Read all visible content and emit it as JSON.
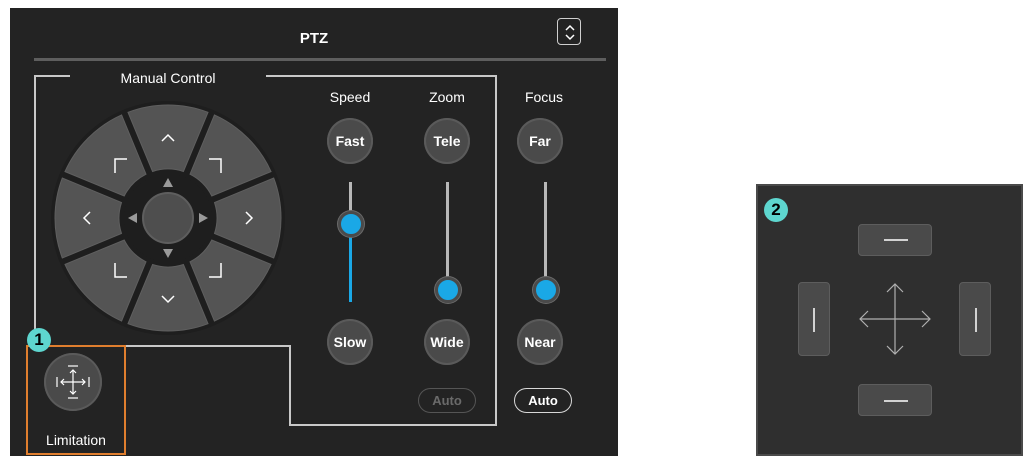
{
  "ptz": {
    "title": "PTZ",
    "collapse_icon": "chevron-up-down-icon"
  },
  "manual_control": {
    "label": "Manual Control",
    "dpad_icons": [
      "arrow-up-icon",
      "arrow-down-icon",
      "arrow-left-icon",
      "arrow-right-icon",
      "arrow-up-left-icon",
      "arrow-up-right-icon",
      "arrow-down-left-icon",
      "arrow-down-right-icon"
    ]
  },
  "speed": {
    "label": "Speed",
    "top_label": "Fast",
    "bottom_label": "Slow",
    "level": 0.65
  },
  "zoom": {
    "label": "Zoom",
    "top_label": "Tele",
    "bottom_label": "Wide",
    "auto_label": "Auto",
    "level": 0.0
  },
  "focus": {
    "label": "Focus",
    "top_label": "Far",
    "bottom_label": "Near",
    "auto_label": "Auto",
    "level": 0.1
  },
  "limitation": {
    "label": "Limitation",
    "icon": "move-limit-icon"
  },
  "badges": {
    "one": "1",
    "two": "2"
  },
  "colors": {
    "panel_bg": "#232323",
    "accent": "#1aa8e6",
    "highlight_box": "#e07e2e",
    "badge": "#5ed6cf"
  }
}
